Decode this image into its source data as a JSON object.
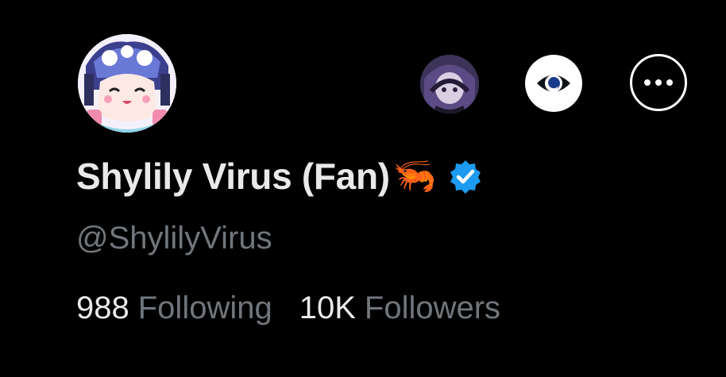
{
  "profile": {
    "display_name": "Shylily Virus (Fan)",
    "name_emoji": "🦐",
    "handle": "@ShylilyVirus",
    "verified": true,
    "verified_color": "#1d9bf0"
  },
  "header_actions": {
    "avatar_icon": "affiliate-avatar-icon",
    "eye_icon": "eye-icon",
    "more_icon": "more-horizontal-icon"
  },
  "stats": {
    "following_count": "988",
    "following_label": "Following",
    "followers_count": "10K",
    "followers_label": "Followers"
  },
  "colors": {
    "background": "#000000",
    "text_primary": "#e7e9ea",
    "text_secondary": "#71767b"
  }
}
